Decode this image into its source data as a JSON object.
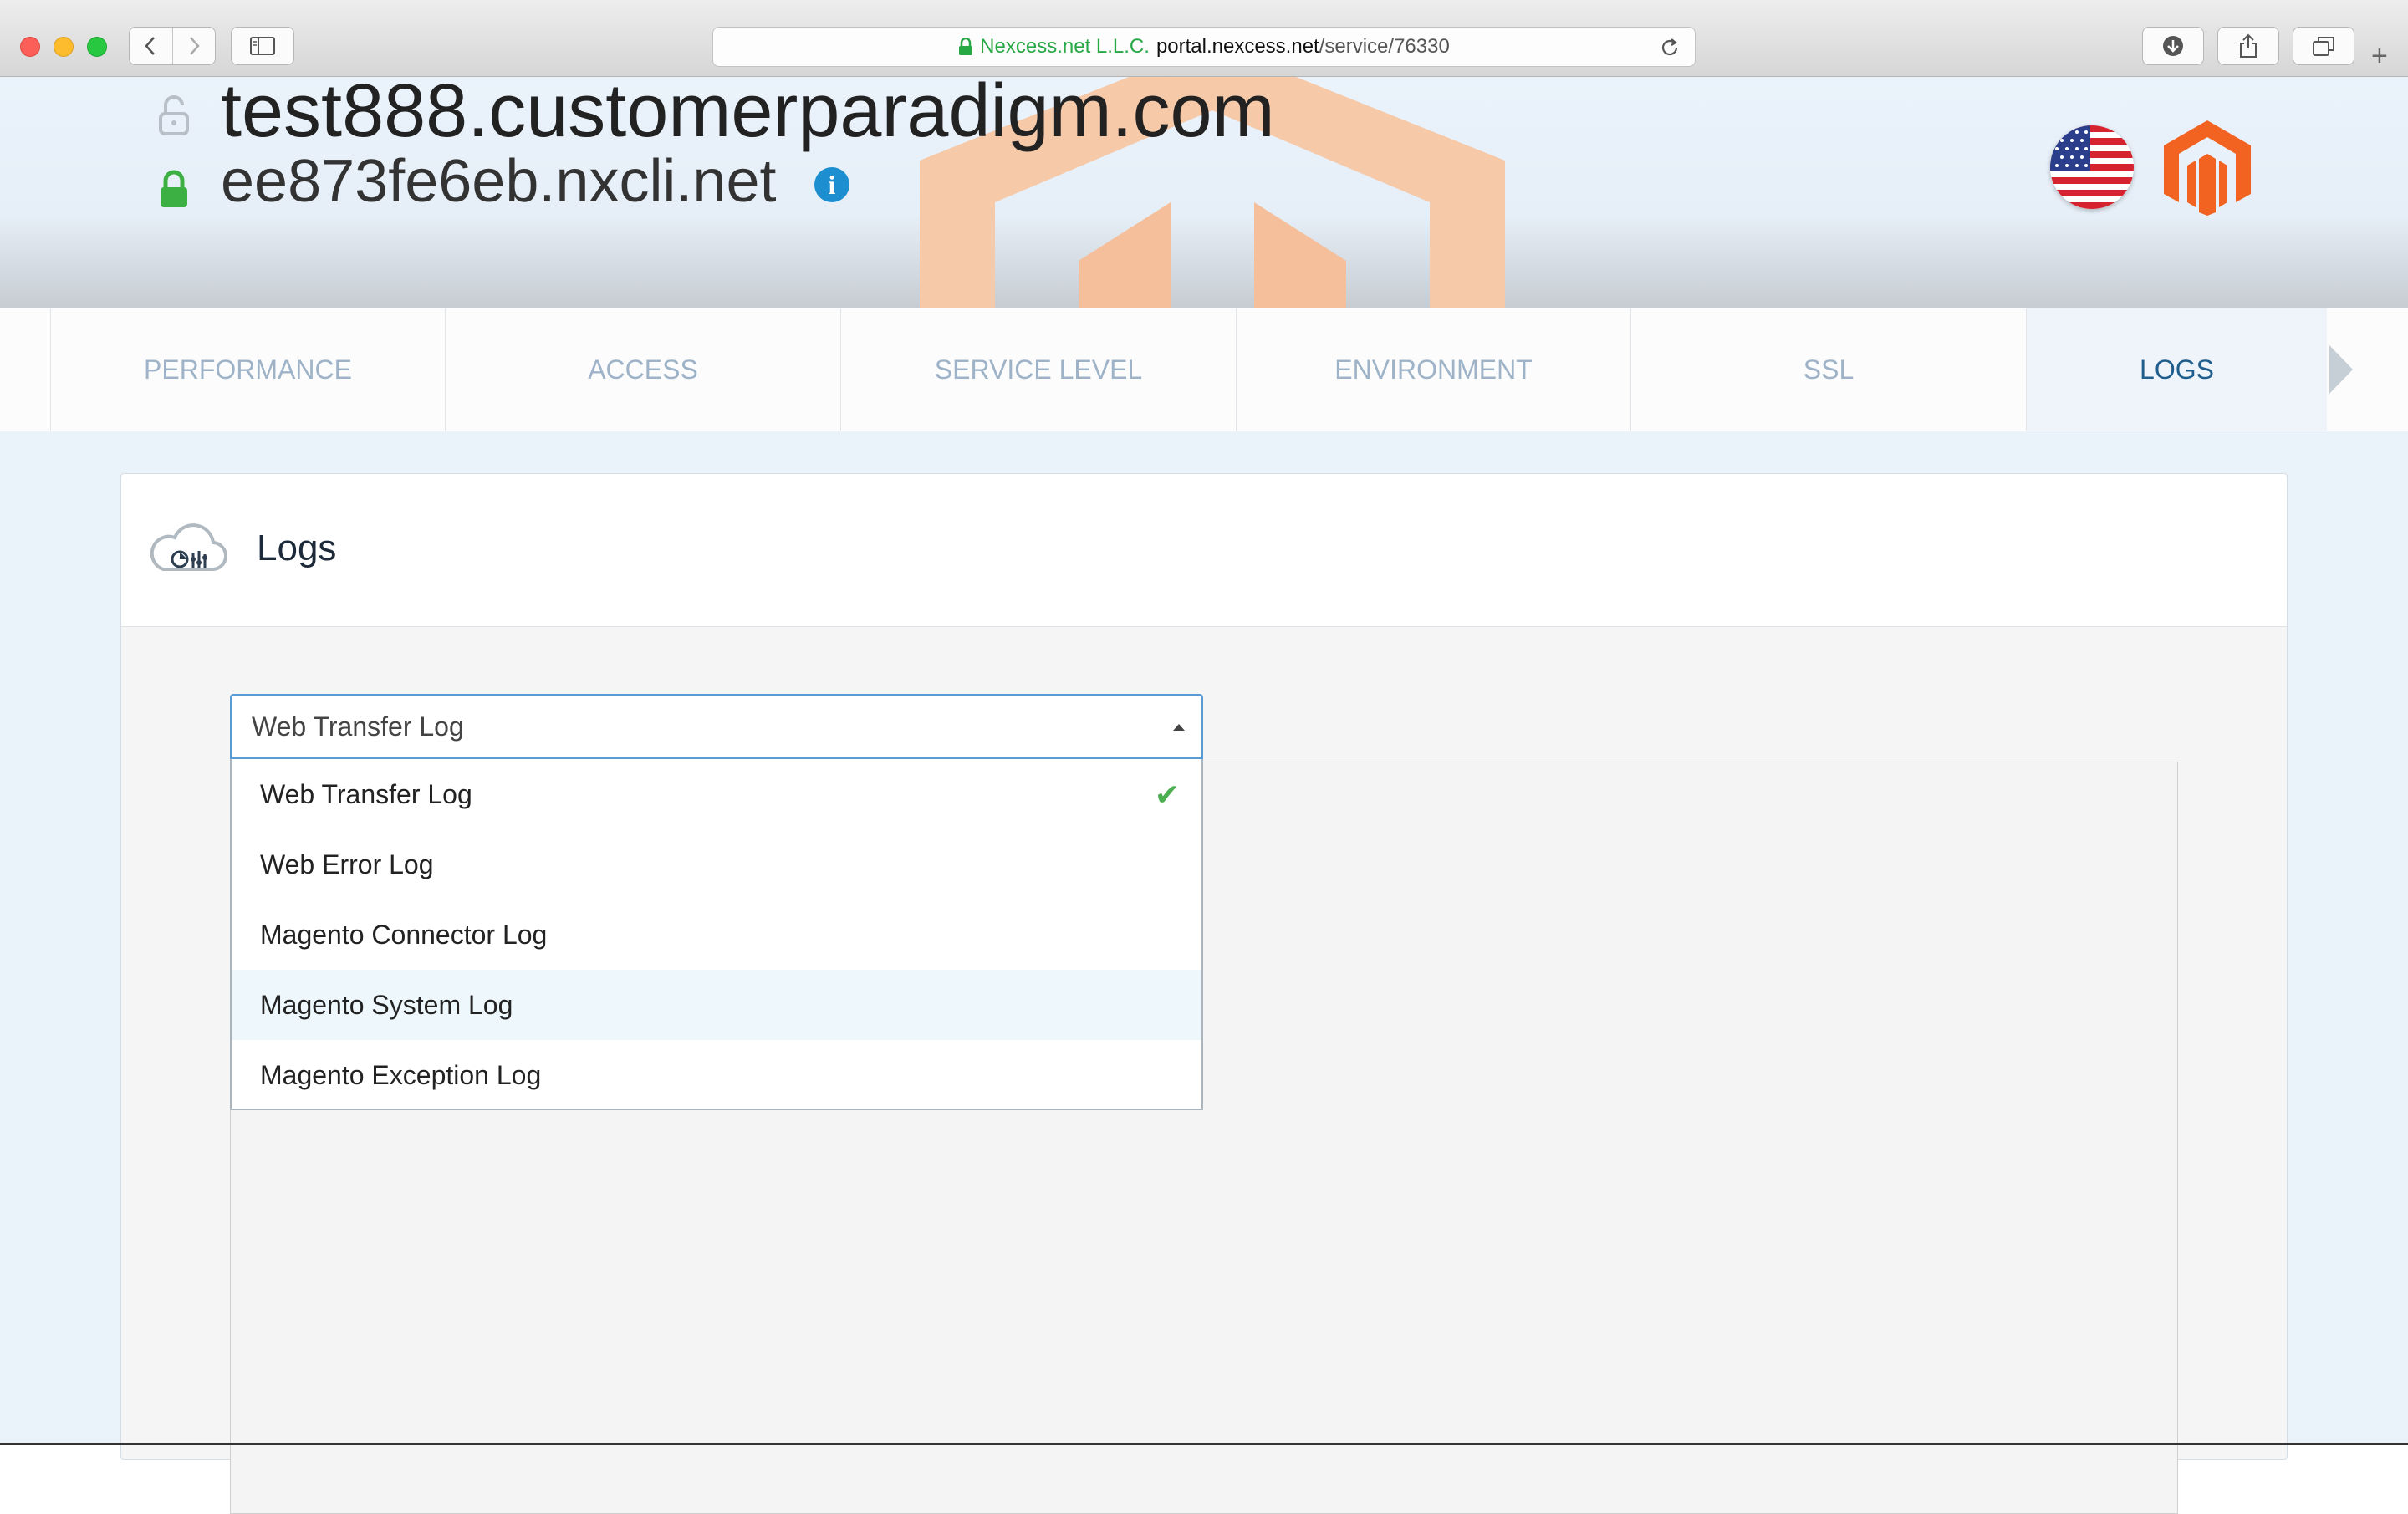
{
  "browser": {
    "url_company": "Nexcess.net L.L.C.",
    "url_host": "portal.nexcess.net",
    "url_path": "/service/76330",
    "newtab_label": "+"
  },
  "header": {
    "domain_primary": "test888.customerparadigm.com",
    "domain_secondary": "ee873fe6eb.nxcli.net",
    "info_label": "i"
  },
  "tabs": [
    {
      "label": "PERFORMANCE"
    },
    {
      "label": "ACCESS"
    },
    {
      "label": "SERVICE LEVEL"
    },
    {
      "label": "ENVIRONMENT"
    },
    {
      "label": "SSL"
    },
    {
      "label": "LOGS"
    }
  ],
  "active_tab": "LOGS",
  "panel": {
    "title": "Logs"
  },
  "log_select": {
    "selected": "Web Transfer Log",
    "options": [
      {
        "label": "Web Transfer Log",
        "checked": true
      },
      {
        "label": "Web Error Log"
      },
      {
        "label": "Magento Connector Log"
      },
      {
        "label": "Magento System Log",
        "highlighted": true
      },
      {
        "label": "Magento Exception Log"
      }
    ],
    "check_glyph": "✔"
  },
  "colors": {
    "accent": "#1f5d8c",
    "secure_green": "#28a745",
    "magento_orange": "#f26322"
  }
}
